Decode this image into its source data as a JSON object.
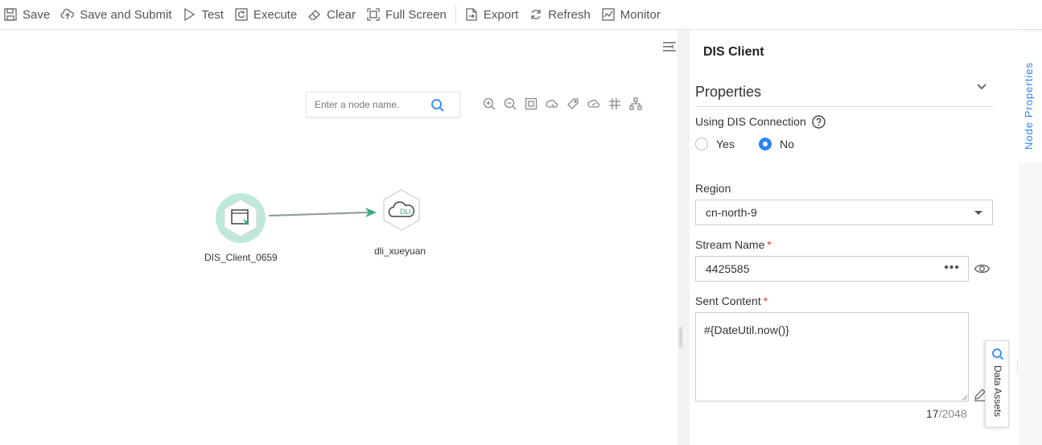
{
  "toolbar": {
    "items": [
      {
        "label": "Save",
        "icon": "save-icon"
      },
      {
        "label": "Save and Submit",
        "icon": "cloud-upload-icon"
      },
      {
        "label": "Test",
        "icon": "play-icon"
      },
      {
        "label": "Execute",
        "icon": "execute-icon"
      },
      {
        "label": "Clear",
        "icon": "eraser-icon"
      },
      {
        "label": "Full Screen",
        "icon": "fullscreen-icon"
      },
      {
        "label": "Export",
        "icon": "export-icon"
      },
      {
        "label": "Refresh",
        "icon": "refresh-icon"
      },
      {
        "label": "Monitor",
        "icon": "monitor-icon"
      }
    ]
  },
  "canvas": {
    "search_placeholder": "Enter a node name.",
    "tools": [
      "zoom-in-icon",
      "zoom-out-icon",
      "fit-icon",
      "node-icon",
      "tag-icon",
      "link-icon",
      "grid-icon",
      "hierarchy-icon"
    ],
    "nodes": [
      {
        "label": "DIS_Client_0659",
        "icon": "dis-client-icon",
        "selected": true
      },
      {
        "label": "dli_xueyuan",
        "icon": "dli-cloud-icon",
        "icon_text": "DLI"
      }
    ],
    "colors": {
      "selected_ring": "#bfe8dc",
      "edge": "#8a9a96",
      "arrow": "#3aa886"
    }
  },
  "panel": {
    "title": "DIS Client",
    "section": "Properties",
    "using_dis_connection": {
      "label": "Using DIS Connection",
      "options": [
        "Yes",
        "No"
      ],
      "selected": "No"
    },
    "region": {
      "label": "Region",
      "value": "cn-north-9"
    },
    "stream_name": {
      "label": "Stream Name",
      "required": "*",
      "value": "4425585",
      "more": "•••"
    },
    "sent_content": {
      "label": "Sent Content",
      "required": "*",
      "value": "#{DateUtil.now()}",
      "count": "17",
      "max": "/2048"
    }
  },
  "side_tabs": {
    "node_properties": "Node Properties",
    "data_assets": "Data Assets"
  },
  "colors": {
    "accent": "#2a84f5",
    "required": "#e33333"
  }
}
